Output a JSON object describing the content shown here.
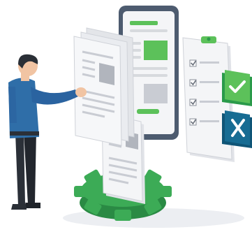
{
  "illustration": {
    "colors": {
      "background": "#ffffff",
      "accent_green": "#5cc15a",
      "dark_green": "#2a9a4a",
      "gear_green": "#3cab56",
      "x_blue": "#176c93",
      "phone_frame": "#4d5b6f",
      "shirt_blue": "#2f6ea8",
      "pants": "#2b3038",
      "skin": "#f1c4a3",
      "hair": "#2a2f36",
      "paper": "#eeeff2",
      "paper_line": "#c9ccd3",
      "image_block": "#b1b5bd"
    },
    "checklist": {
      "rows": 4,
      "approve_symbol": "check",
      "reject_symbol": "x"
    },
    "icons": [
      "person",
      "document-stack",
      "smartphone",
      "clipboard-checklist",
      "check-icon",
      "x-icon",
      "gear-icon"
    ]
  }
}
